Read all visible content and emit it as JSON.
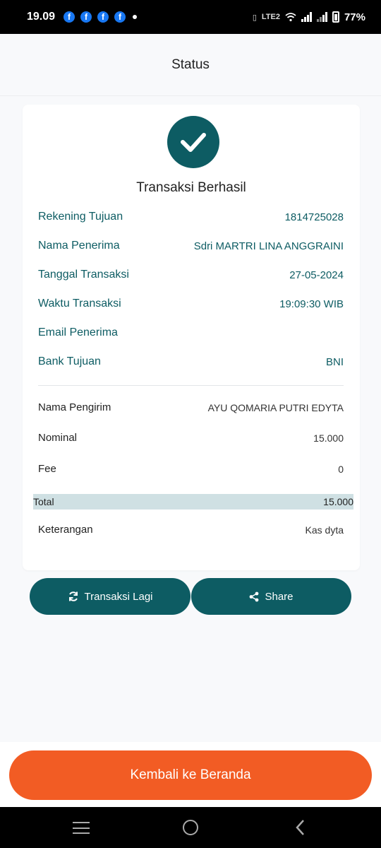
{
  "status_bar": {
    "time": "19.09",
    "battery_percent": "77%",
    "network_label": "LTE2",
    "notification_icons": [
      "facebook-icon",
      "facebook-icon",
      "facebook-icon",
      "facebook-icon"
    ]
  },
  "header": {
    "title": "Status"
  },
  "result": {
    "title": "Transaksi Berhasil",
    "icon": "check-icon"
  },
  "recipient_details": [
    {
      "label": "Rekening Tujuan",
      "value": "1814725028"
    },
    {
      "label": "Nama Penerima",
      "value": "Sdri MARTRI LINA ANGGRAINI"
    },
    {
      "label": "Tanggal Transaksi",
      "value": "27-05-2024"
    },
    {
      "label": "Waktu Transaksi",
      "value": "19:09:30 WIB"
    },
    {
      "label": "Email Penerima",
      "value": ""
    },
    {
      "label": "Bank Tujuan",
      "value": "BNI"
    }
  ],
  "sender_details": [
    {
      "label": "Nama Pengirim",
      "value": "AYU QOMARIA PUTRI EDYTA"
    },
    {
      "label": "Nominal",
      "value": "15.000"
    },
    {
      "label": "Fee",
      "value": "0"
    }
  ],
  "total": {
    "label": "Total",
    "value": "15.000"
  },
  "note": {
    "label": "Keterangan",
    "value": "Kas dyta"
  },
  "actions": {
    "again_label": "Transaksi Lagi",
    "again_icon": "refresh-icon",
    "share_label": "Share",
    "share_icon": "share-icon"
  },
  "home_button": {
    "label": "Kembali ke Beranda"
  },
  "colors": {
    "primary": "#0d5c63",
    "accent": "#f25c24",
    "total_highlight": "#cfe0e3",
    "background": "#f8f9fb"
  }
}
